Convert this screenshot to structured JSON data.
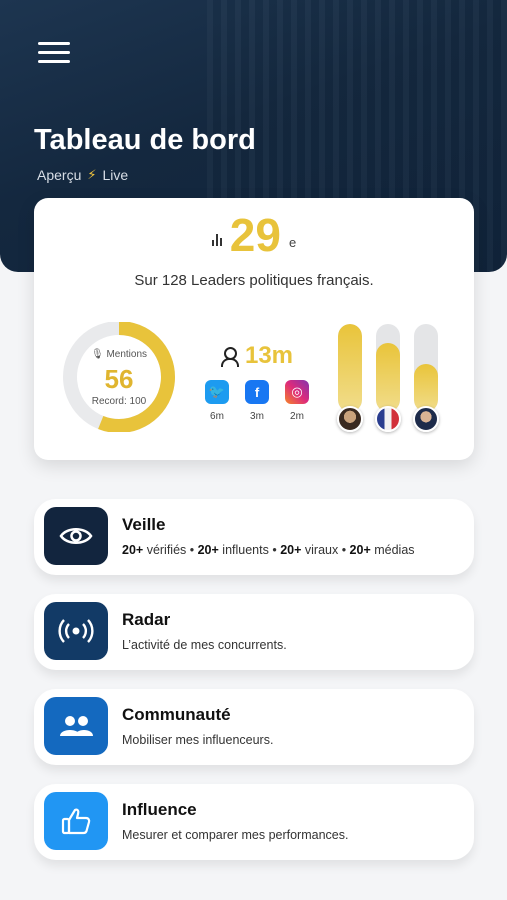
{
  "header": {
    "title": "Tableau de bord",
    "subtitle_left": "Aperçu",
    "subtitle_right": "Live"
  },
  "ranking": {
    "position": "29",
    "suffix": "e",
    "caption": "Sur 128 Leaders politiques français."
  },
  "mentions": {
    "label": "Mentions",
    "value": "56",
    "record": "Record: 100",
    "fraction": 0.56
  },
  "audience": {
    "followers": "13m",
    "networks": [
      {
        "name": "twitter",
        "value": "6m",
        "color": "#1d9bf0"
      },
      {
        "name": "facebook",
        "value": "3m",
        "color": "#1877f2"
      },
      {
        "name": "instagram",
        "value": "2m",
        "color": "#d62976"
      }
    ]
  },
  "leaders_comparison": [
    {
      "fill": 1.0
    },
    {
      "fill": 0.78
    },
    {
      "fill": 0.55
    }
  ],
  "menu": [
    {
      "title": "Veille",
      "desc_parts": [
        "20+",
        " vérifiés • ",
        "20+",
        " influents • ",
        "20+",
        " viraux • ",
        "20+",
        " médias"
      ],
      "icon": "eye-icon",
      "color": "#12253e"
    },
    {
      "title": "Radar",
      "desc": "L’activité de mes concurrents.",
      "icon": "broadcast-icon",
      "color": "#123a66"
    },
    {
      "title": "Communauté",
      "desc": "Mobiliser mes influenceurs.",
      "icon": "group-icon",
      "color": "#1469bf"
    },
    {
      "title": "Influence",
      "desc": "Mesurer et comparer mes performances.",
      "icon": "thumbs-up-icon",
      "color": "#2196f3"
    }
  ]
}
